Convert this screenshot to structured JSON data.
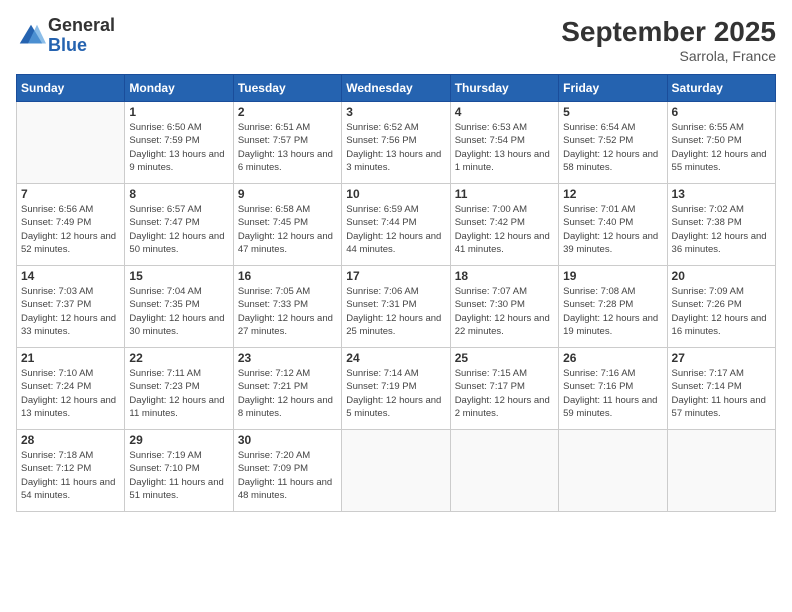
{
  "logo": {
    "general": "General",
    "blue": "Blue"
  },
  "title": "September 2025",
  "location": "Sarrola, France",
  "days_header": [
    "Sunday",
    "Monday",
    "Tuesday",
    "Wednesday",
    "Thursday",
    "Friday",
    "Saturday"
  ],
  "weeks": [
    [
      {
        "day": "",
        "sunrise": "",
        "sunset": "",
        "daylight": ""
      },
      {
        "day": "1",
        "sunrise": "Sunrise: 6:50 AM",
        "sunset": "Sunset: 7:59 PM",
        "daylight": "Daylight: 13 hours and 9 minutes."
      },
      {
        "day": "2",
        "sunrise": "Sunrise: 6:51 AM",
        "sunset": "Sunset: 7:57 PM",
        "daylight": "Daylight: 13 hours and 6 minutes."
      },
      {
        "day": "3",
        "sunrise": "Sunrise: 6:52 AM",
        "sunset": "Sunset: 7:56 PM",
        "daylight": "Daylight: 13 hours and 3 minutes."
      },
      {
        "day": "4",
        "sunrise": "Sunrise: 6:53 AM",
        "sunset": "Sunset: 7:54 PM",
        "daylight": "Daylight: 13 hours and 1 minute."
      },
      {
        "day": "5",
        "sunrise": "Sunrise: 6:54 AM",
        "sunset": "Sunset: 7:52 PM",
        "daylight": "Daylight: 12 hours and 58 minutes."
      },
      {
        "day": "6",
        "sunrise": "Sunrise: 6:55 AM",
        "sunset": "Sunset: 7:50 PM",
        "daylight": "Daylight: 12 hours and 55 minutes."
      }
    ],
    [
      {
        "day": "7",
        "sunrise": "Sunrise: 6:56 AM",
        "sunset": "Sunset: 7:49 PM",
        "daylight": "Daylight: 12 hours and 52 minutes."
      },
      {
        "day": "8",
        "sunrise": "Sunrise: 6:57 AM",
        "sunset": "Sunset: 7:47 PM",
        "daylight": "Daylight: 12 hours and 50 minutes."
      },
      {
        "day": "9",
        "sunrise": "Sunrise: 6:58 AM",
        "sunset": "Sunset: 7:45 PM",
        "daylight": "Daylight: 12 hours and 47 minutes."
      },
      {
        "day": "10",
        "sunrise": "Sunrise: 6:59 AM",
        "sunset": "Sunset: 7:44 PM",
        "daylight": "Daylight: 12 hours and 44 minutes."
      },
      {
        "day": "11",
        "sunrise": "Sunrise: 7:00 AM",
        "sunset": "Sunset: 7:42 PM",
        "daylight": "Daylight: 12 hours and 41 minutes."
      },
      {
        "day": "12",
        "sunrise": "Sunrise: 7:01 AM",
        "sunset": "Sunset: 7:40 PM",
        "daylight": "Daylight: 12 hours and 39 minutes."
      },
      {
        "day": "13",
        "sunrise": "Sunrise: 7:02 AM",
        "sunset": "Sunset: 7:38 PM",
        "daylight": "Daylight: 12 hours and 36 minutes."
      }
    ],
    [
      {
        "day": "14",
        "sunrise": "Sunrise: 7:03 AM",
        "sunset": "Sunset: 7:37 PM",
        "daylight": "Daylight: 12 hours and 33 minutes."
      },
      {
        "day": "15",
        "sunrise": "Sunrise: 7:04 AM",
        "sunset": "Sunset: 7:35 PM",
        "daylight": "Daylight: 12 hours and 30 minutes."
      },
      {
        "day": "16",
        "sunrise": "Sunrise: 7:05 AM",
        "sunset": "Sunset: 7:33 PM",
        "daylight": "Daylight: 12 hours and 27 minutes."
      },
      {
        "day": "17",
        "sunrise": "Sunrise: 7:06 AM",
        "sunset": "Sunset: 7:31 PM",
        "daylight": "Daylight: 12 hours and 25 minutes."
      },
      {
        "day": "18",
        "sunrise": "Sunrise: 7:07 AM",
        "sunset": "Sunset: 7:30 PM",
        "daylight": "Daylight: 12 hours and 22 minutes."
      },
      {
        "day": "19",
        "sunrise": "Sunrise: 7:08 AM",
        "sunset": "Sunset: 7:28 PM",
        "daylight": "Daylight: 12 hours and 19 minutes."
      },
      {
        "day": "20",
        "sunrise": "Sunrise: 7:09 AM",
        "sunset": "Sunset: 7:26 PM",
        "daylight": "Daylight: 12 hours and 16 minutes."
      }
    ],
    [
      {
        "day": "21",
        "sunrise": "Sunrise: 7:10 AM",
        "sunset": "Sunset: 7:24 PM",
        "daylight": "Daylight: 12 hours and 13 minutes."
      },
      {
        "day": "22",
        "sunrise": "Sunrise: 7:11 AM",
        "sunset": "Sunset: 7:23 PM",
        "daylight": "Daylight: 12 hours and 11 minutes."
      },
      {
        "day": "23",
        "sunrise": "Sunrise: 7:12 AM",
        "sunset": "Sunset: 7:21 PM",
        "daylight": "Daylight: 12 hours and 8 minutes."
      },
      {
        "day": "24",
        "sunrise": "Sunrise: 7:14 AM",
        "sunset": "Sunset: 7:19 PM",
        "daylight": "Daylight: 12 hours and 5 minutes."
      },
      {
        "day": "25",
        "sunrise": "Sunrise: 7:15 AM",
        "sunset": "Sunset: 7:17 PM",
        "daylight": "Daylight: 12 hours and 2 minutes."
      },
      {
        "day": "26",
        "sunrise": "Sunrise: 7:16 AM",
        "sunset": "Sunset: 7:16 PM",
        "daylight": "Daylight: 11 hours and 59 minutes."
      },
      {
        "day": "27",
        "sunrise": "Sunrise: 7:17 AM",
        "sunset": "Sunset: 7:14 PM",
        "daylight": "Daylight: 11 hours and 57 minutes."
      }
    ],
    [
      {
        "day": "28",
        "sunrise": "Sunrise: 7:18 AM",
        "sunset": "Sunset: 7:12 PM",
        "daylight": "Daylight: 11 hours and 54 minutes."
      },
      {
        "day": "29",
        "sunrise": "Sunrise: 7:19 AM",
        "sunset": "Sunset: 7:10 PM",
        "daylight": "Daylight: 11 hours and 51 minutes."
      },
      {
        "day": "30",
        "sunrise": "Sunrise: 7:20 AM",
        "sunset": "Sunset: 7:09 PM",
        "daylight": "Daylight: 11 hours and 48 minutes."
      },
      {
        "day": "",
        "sunrise": "",
        "sunset": "",
        "daylight": ""
      },
      {
        "day": "",
        "sunrise": "",
        "sunset": "",
        "daylight": ""
      },
      {
        "day": "",
        "sunrise": "",
        "sunset": "",
        "daylight": ""
      },
      {
        "day": "",
        "sunrise": "",
        "sunset": "",
        "daylight": ""
      }
    ]
  ]
}
